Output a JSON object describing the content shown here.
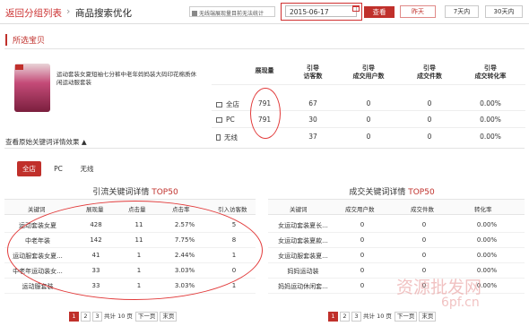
{
  "header": {
    "back_label": "返回分组列表",
    "separator": "›",
    "title": "商品搜索优化",
    "notice": "无线端展现量目前无法统计",
    "date_value": "2015-06-17",
    "query_label": "查看",
    "ranges": [
      "昨天",
      "7天内",
      "30天内"
    ]
  },
  "section": {
    "title": "所选宝贝"
  },
  "product": {
    "name": "运动套装女夏短袖七分裤中老年妈妈装大码印花棉质休闲运动服套装",
    "table_headers": [
      "展现量",
      "引导\n访客数",
      "引导\n成交用户数",
      "引导\n成交件数",
      "引导\n成交转化率"
    ],
    "rows": [
      {
        "label": "全店",
        "icon": "store-icon",
        "impressions": "791",
        "visitors": "67",
        "buyers": "0",
        "items": "0",
        "conversion": "0.00%"
      },
      {
        "label": "PC",
        "icon": "monitor-icon",
        "impressions": "791",
        "visitors": "30",
        "buyers": "0",
        "items": "0",
        "conversion": "0.00%"
      },
      {
        "label": "无线",
        "icon": "mobile-icon",
        "impressions": "",
        "visitors": "37",
        "buyers": "0",
        "items": "0",
        "conversion": "0.00%"
      }
    ],
    "expand_label": "查看原始关键词详情效果 ▲"
  },
  "tabs": [
    "全店",
    "PC",
    "无线"
  ],
  "traffic_table": {
    "title": "引流关键词详情",
    "top_label": "TOP50",
    "headers": [
      "关键词",
      "展现量",
      "点击量",
      "点击率",
      "引入访客数"
    ],
    "rows": [
      [
        "运动套装女夏",
        "428",
        "11",
        "2.57%",
        "5"
      ],
      [
        "中老年装",
        "142",
        "11",
        "7.75%",
        "8"
      ],
      [
        "运动服套装女夏...",
        "41",
        "1",
        "2.44%",
        "1"
      ],
      [
        "中老年运动装女...",
        "33",
        "1",
        "3.03%",
        "0"
      ],
      [
        "运动服套装",
        "33",
        "1",
        "3.03%",
        "1"
      ]
    ],
    "pager": {
      "pages": [
        "1",
        "2",
        "3"
      ],
      "total": "共计 10 页",
      "next": "下一页",
      "last": "末页"
    }
  },
  "deal_table": {
    "title": "成交关键词详情",
    "top_label": "TOP50",
    "headers": [
      "关键词",
      "成交用户数",
      "成交件数",
      "转化率"
    ],
    "rows": [
      [
        "女运动套装夏长...",
        "0",
        "0",
        "0.00%"
      ],
      [
        "女运动套装夏款...",
        "0",
        "0",
        "0.00%"
      ],
      [
        "女运动服套装夏...",
        "0",
        "0",
        "0.00%"
      ],
      [
        "妈妈运动装",
        "0",
        "0",
        "0.00%"
      ],
      [
        "妈妈运动休闲套...",
        "0",
        "0",
        "0.00%"
      ]
    ],
    "pager": {
      "pages": [
        "1",
        "2",
        "3"
      ],
      "total": "共计 10 页",
      "next": "下一页",
      "last": "末页"
    }
  },
  "watermark": {
    "text": "资源批发网",
    "domain": "6pf.cn"
  },
  "colors": {
    "accent": "#c0302b",
    "annotation": "#e23b3b"
  }
}
